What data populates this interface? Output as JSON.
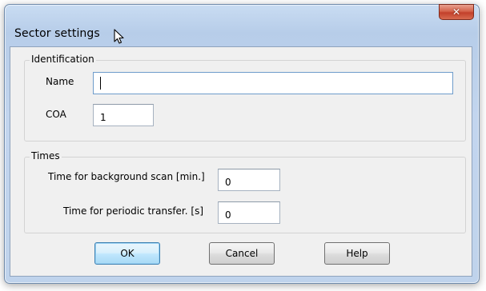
{
  "window": {
    "title": "Sector settings",
    "close_glyph": "✕"
  },
  "identification": {
    "title": "Identification",
    "name_label": "Name",
    "name_value": "",
    "coa_label": "COA",
    "coa_value": "1"
  },
  "times": {
    "title": "Times",
    "background_scan_label": "Time for background scan [min.]",
    "background_scan_value": "0",
    "periodic_transfer_label": "Time for periodic transfer. [s]",
    "periodic_transfer_value": "0"
  },
  "buttons": {
    "ok": "OK",
    "cancel": "Cancel",
    "help": "Help"
  },
  "icons": {
    "close": "close-icon",
    "cursor": "mouse-pointer-icon"
  }
}
